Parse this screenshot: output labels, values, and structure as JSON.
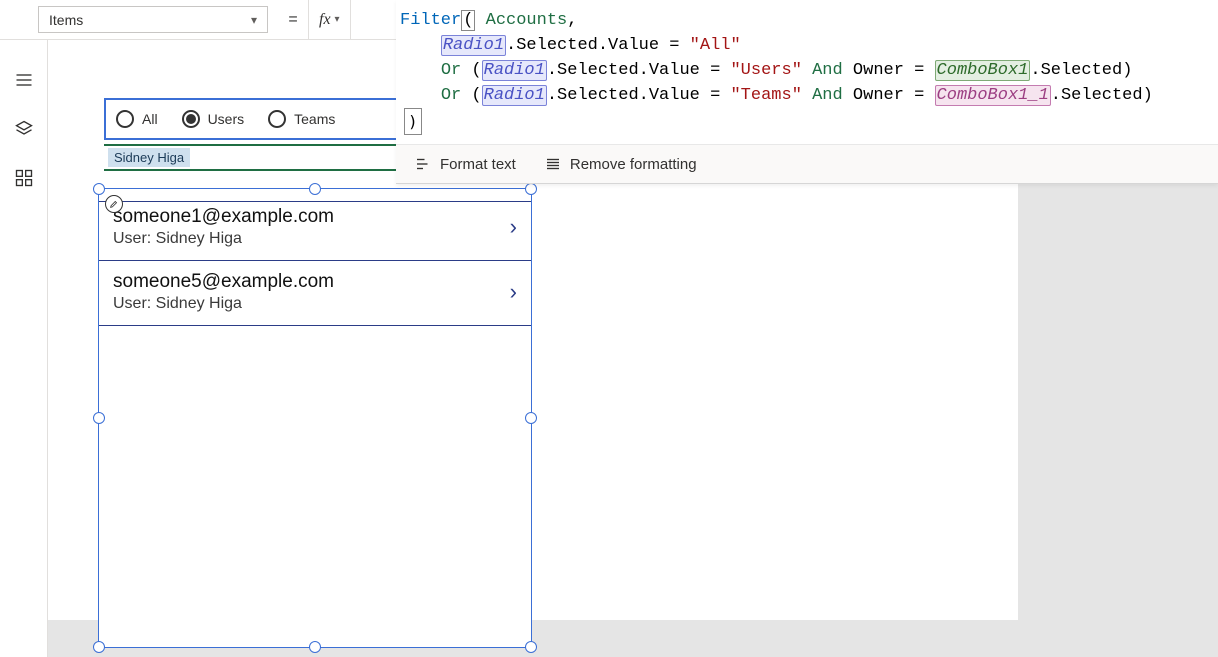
{
  "propertyDropdown": {
    "value": "Items"
  },
  "formula": {
    "fn": "Filter",
    "source": "Accounts",
    "radio": "Radio1",
    "combo1": "ComboBox1",
    "combo2": "ComboBox1_1",
    "valAll": "\"All\"",
    "valUsers": "\"Users\"",
    "valTeams": "\"Teams\"",
    "kwOr": "Or",
    "kwAnd": "And",
    "fieldOwner": "Owner",
    "dotSelectedValue": ".Selected.Value",
    "dotSelected": ".Selected"
  },
  "toolbar": {
    "formatText": "Format text",
    "removeFormatting": "Remove formatting"
  },
  "radio": {
    "options": [
      "All",
      "Users",
      "Teams"
    ],
    "selectedIndex": 1
  },
  "combo": {
    "chip": "Sidney Higa"
  },
  "gallery": {
    "items": [
      {
        "title": "someone1@example.com",
        "subtitle": "User: Sidney Higa"
      },
      {
        "title": "someone5@example.com",
        "subtitle": "User: Sidney Higa"
      }
    ]
  }
}
